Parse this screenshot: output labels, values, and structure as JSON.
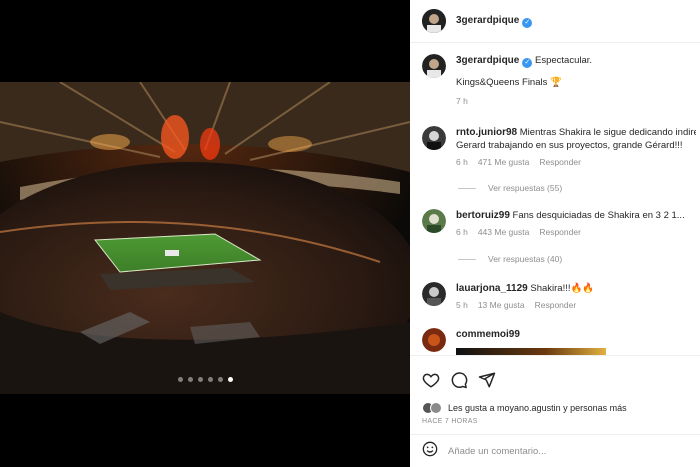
{
  "header": {
    "username": "3gerardpique",
    "verified_icon": "check-icon"
  },
  "caption": {
    "username": "3gerardpique",
    "text": "Espectacular.",
    "line2": "Kings&Queens Finals",
    "trophy_icon": "🏆",
    "time": "7 h"
  },
  "comments": [
    {
      "username": "rnto.junior98",
      "text": "Mientras Shakira le sigue dedicando indire Gerard trabajando en sus proyectos, grande Gérard!!!",
      "time": "6 h",
      "likes": "471 Me gusta",
      "reply_label": "Responder",
      "view_replies": "Ver respuestas (55)"
    },
    {
      "username": "bertoruiz99",
      "text": "Fans desquiciadas de Shakira en 3 2 1...",
      "time": "6 h",
      "likes": "443 Me gusta",
      "reply_label": "Responder",
      "view_replies": "Ver respuestas (40)"
    },
    {
      "username": "lauarjona_1129",
      "text": "Shakira!!!🔥🔥",
      "time": "5 h",
      "likes": "13 Me gusta",
      "reply_label": "Responder"
    },
    {
      "username": "commemoi99",
      "text": ""
    }
  ],
  "actions": {
    "like_icon": "heart-icon",
    "comment_icon": "comment-icon",
    "share_icon": "send-icon",
    "likes_text": "Les gusta a moyano.agustin y personas más",
    "time_ago": "HACE 7 HORAS",
    "comment_placeholder": "Añade un comentario..."
  },
  "carousel": {
    "count": 6,
    "active_index": 5
  },
  "colors": {
    "verified": "#3897f0",
    "muted": "#8e8e8e",
    "text": "#262626"
  }
}
